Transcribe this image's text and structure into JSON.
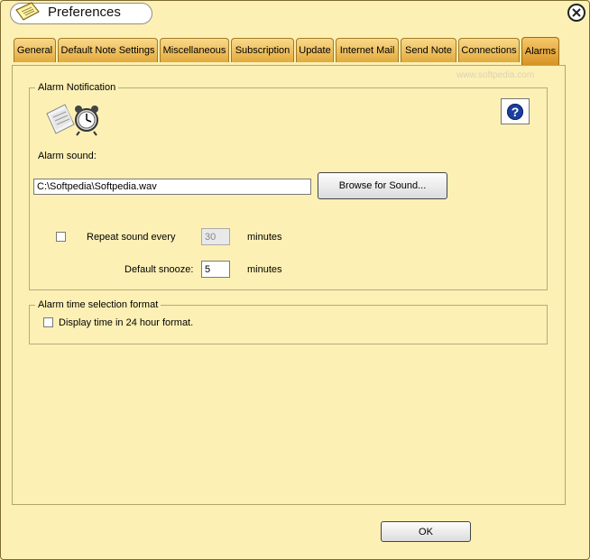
{
  "window": {
    "title": "Preferences"
  },
  "tabs": [
    {
      "label": "General"
    },
    {
      "label": "Default Note Settings"
    },
    {
      "label": "Miscellaneous"
    },
    {
      "label": "Subscription"
    },
    {
      "label": "Update"
    },
    {
      "label": "Internet Mail"
    },
    {
      "label": "Send Note"
    },
    {
      "label": "Connections"
    },
    {
      "label": "Alarms"
    }
  ],
  "watermark": "www.softpedia.com",
  "alarm_notification": {
    "legend": "Alarm Notification",
    "alarm_sound_label": "Alarm sound:",
    "sound_path": "C:\\Softpedia\\Softpedia.wav",
    "browse_label": "Browse for Sound...",
    "repeat_label": "Repeat sound every",
    "repeat_value": "30",
    "repeat_unit": "minutes",
    "snooze_label": "Default snooze:",
    "snooze_value": "5",
    "snooze_unit": "minutes",
    "help_glyph": "?"
  },
  "time_format": {
    "legend": "Alarm time selection format",
    "display24_label": "Display time in 24 hour format."
  },
  "footer": {
    "ok_label": "OK"
  },
  "colors": {
    "background": "#fdf0b4",
    "tab": "#e3aa3c",
    "help_icon": "#1b3f9e"
  }
}
